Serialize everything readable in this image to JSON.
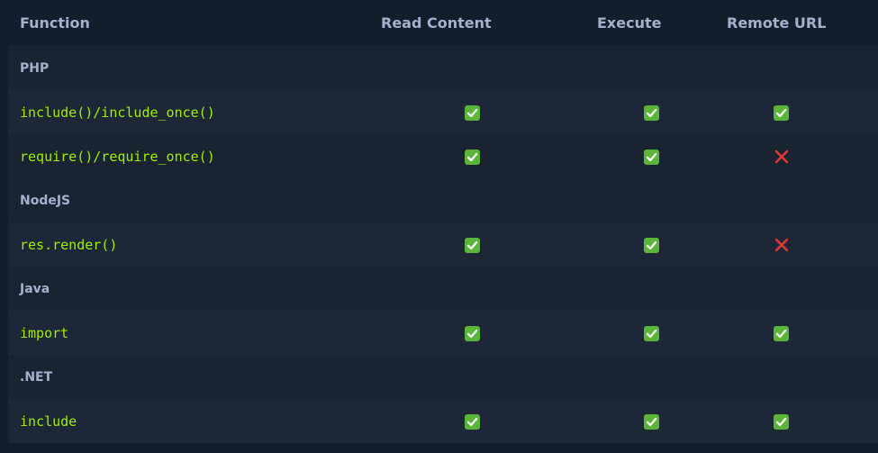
{
  "headers": {
    "function": "Function",
    "read": "Read Content",
    "execute": "Execute",
    "remote": "Remote URL"
  },
  "groups": [
    {
      "name": "PHP",
      "rows": [
        {
          "fn": "include()/include_once()",
          "read": "check-icon",
          "execute": "check-icon",
          "remote": "check-icon"
        },
        {
          "fn": "require()/require_once()",
          "read": "check-icon",
          "execute": "check-icon",
          "remote": "cross-icon"
        }
      ]
    },
    {
      "name": "NodeJS",
      "rows": [
        {
          "fn": "res.render()",
          "read": "check-icon",
          "execute": "check-icon",
          "remote": "cross-icon"
        }
      ]
    },
    {
      "name": "Java",
      "rows": [
        {
          "fn": "import",
          "read": "check-icon",
          "execute": "check-icon",
          "remote": "check-icon"
        }
      ]
    },
    {
      "name": ".NET",
      "rows": [
        {
          "fn": "include",
          "read": "check-icon",
          "execute": "check-icon",
          "remote": "check-icon"
        }
      ]
    }
  ],
  "colors": {
    "background": "#141d2b",
    "accent_green": "#9fef00",
    "check_green": "#5bb53b",
    "cross_red": "#e0392f"
  }
}
